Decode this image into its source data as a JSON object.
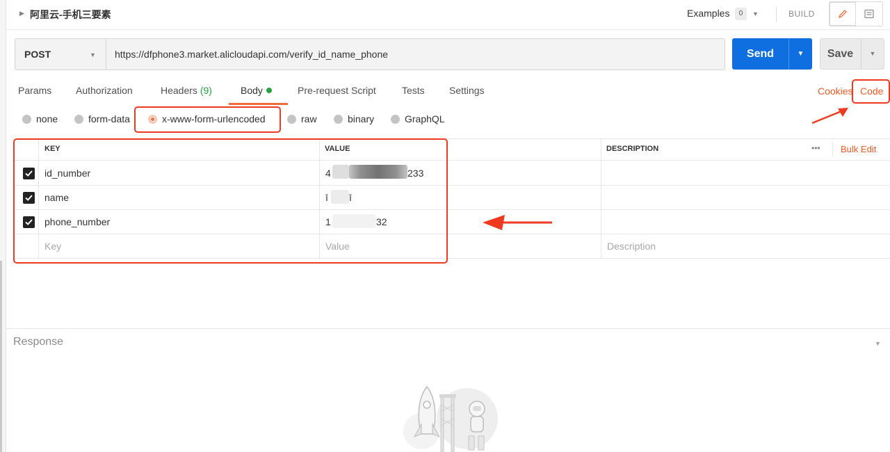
{
  "request": {
    "name": "阿里云-手机三要素",
    "method": "POST",
    "url": "https://dfphone3.market.alicloudapi.com/verify_id_name_phone"
  },
  "header": {
    "examples_label": "Examples",
    "examples_count": "0",
    "build_label": "BUILD"
  },
  "actions": {
    "send_label": "Send",
    "save_label": "Save"
  },
  "tabs": {
    "params": "Params",
    "authorization": "Authorization",
    "headers": "Headers",
    "headers_count": "(9)",
    "body": "Body",
    "prerequest": "Pre-request Script",
    "tests": "Tests",
    "settings": "Settings",
    "cookies": "Cookies",
    "code": "Code",
    "active": "Body"
  },
  "body_types": {
    "none": "none",
    "form_data": "form-data",
    "urlencoded": "x-www-form-urlencoded",
    "raw": "raw",
    "binary": "binary",
    "graphql": "GraphQL",
    "selected": "x-www-form-urlencoded"
  },
  "table": {
    "col_key": "KEY",
    "col_value": "VALUE",
    "col_description": "DESCRIPTION",
    "more": "•••",
    "bulk_edit": "Bulk Edit",
    "rows": [
      {
        "key": "id_number",
        "value_prefix": "4",
        "value_suffix": "233",
        "checked": true
      },
      {
        "key": "name",
        "value_prefix": "ī",
        "value_suffix": "ī",
        "checked": true
      },
      {
        "key": "phone_number",
        "value_prefix": "1",
        "value_suffix": "32",
        "checked": true
      }
    ],
    "placeholder": {
      "key": "Key",
      "value": "Value",
      "description": "Description"
    }
  },
  "response": {
    "label": "Response"
  },
  "colors": {
    "accent": "#f26b3a",
    "send_blue": "#0f6fe0",
    "annotation_red": "#f03a1f",
    "status_green": "#26a23f"
  }
}
